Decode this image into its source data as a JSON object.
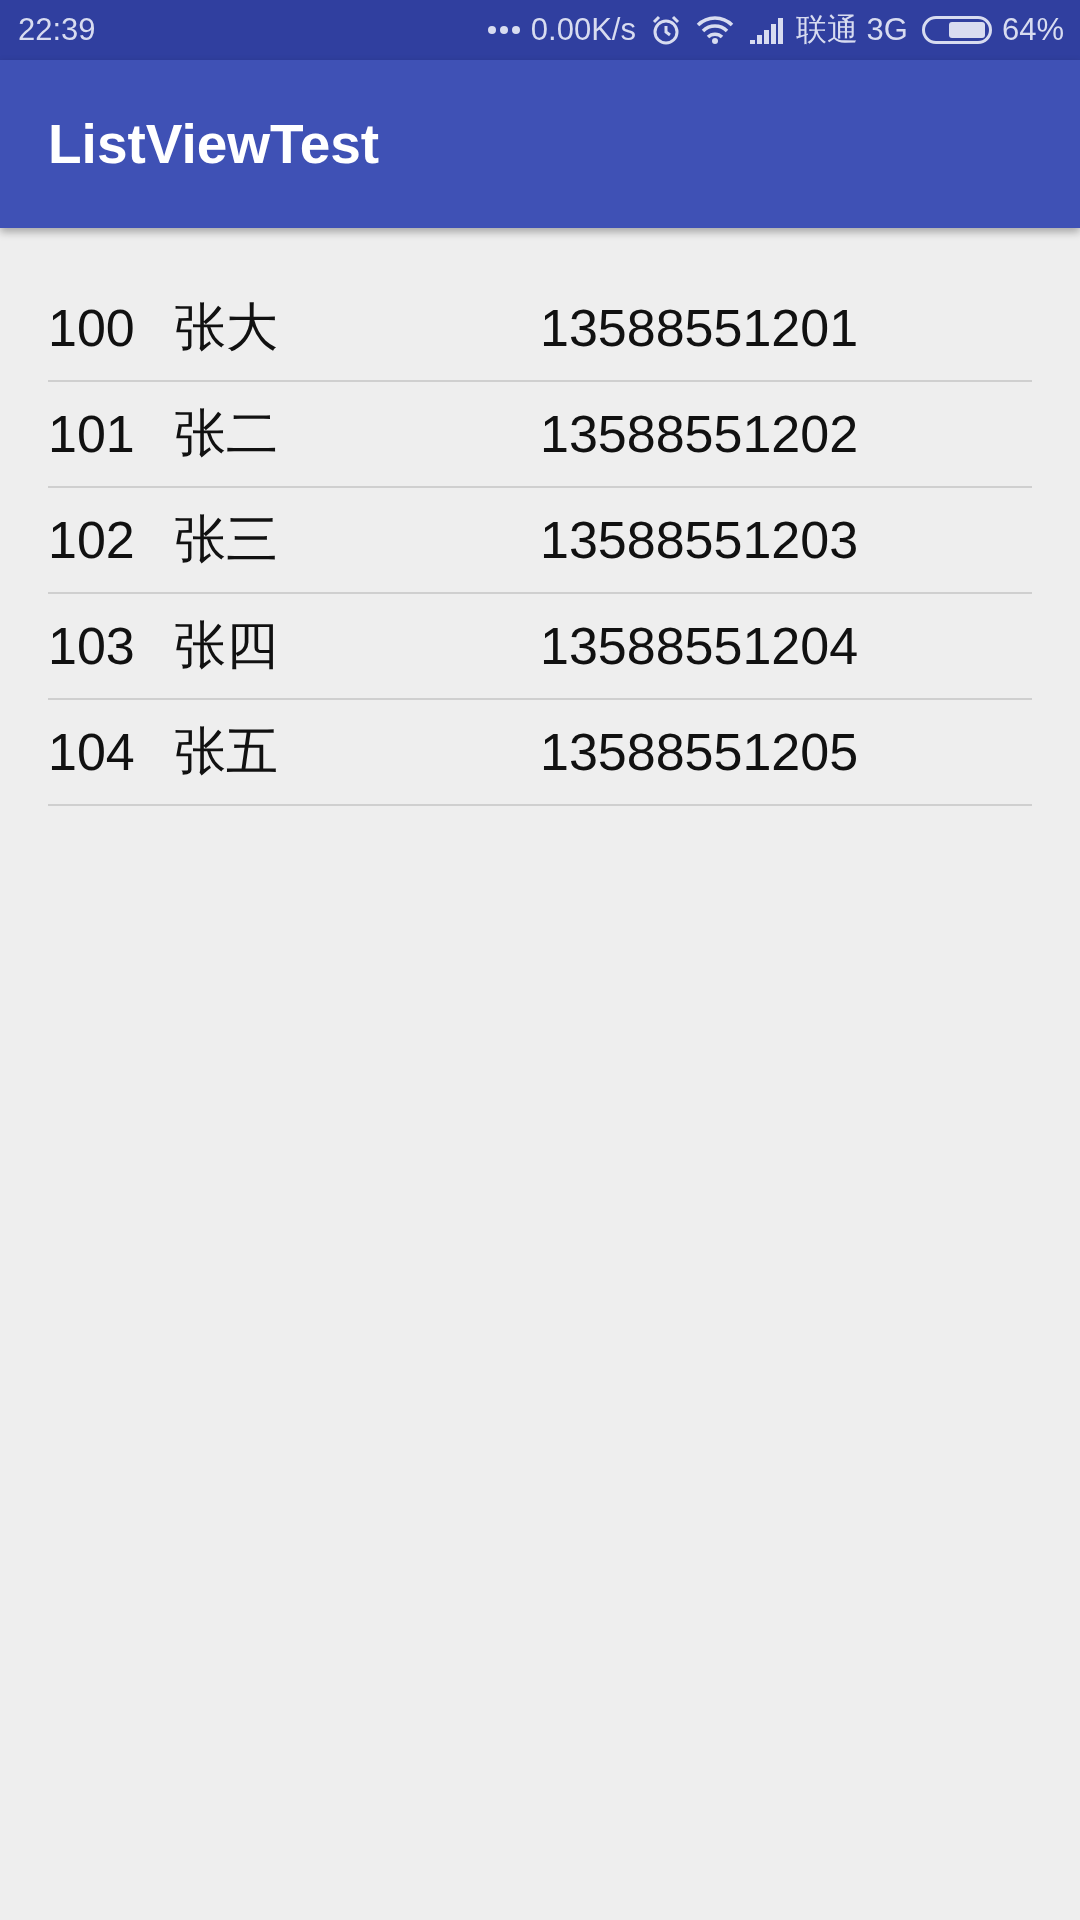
{
  "status_bar": {
    "time": "22:39",
    "net_speed": "0.00K/s",
    "carrier": "联通 3G",
    "battery": "64%"
  },
  "app_bar": {
    "title": "ListViewTest"
  },
  "list": [
    {
      "id": "100",
      "name": "张大",
      "phone": "13588551201"
    },
    {
      "id": "101",
      "name": "张二",
      "phone": "13588551202"
    },
    {
      "id": "102",
      "name": "张三",
      "phone": "13588551203"
    },
    {
      "id": "103",
      "name": "张四",
      "phone": "13588551204"
    },
    {
      "id": "104",
      "name": "张五",
      "phone": "13588551205"
    }
  ]
}
